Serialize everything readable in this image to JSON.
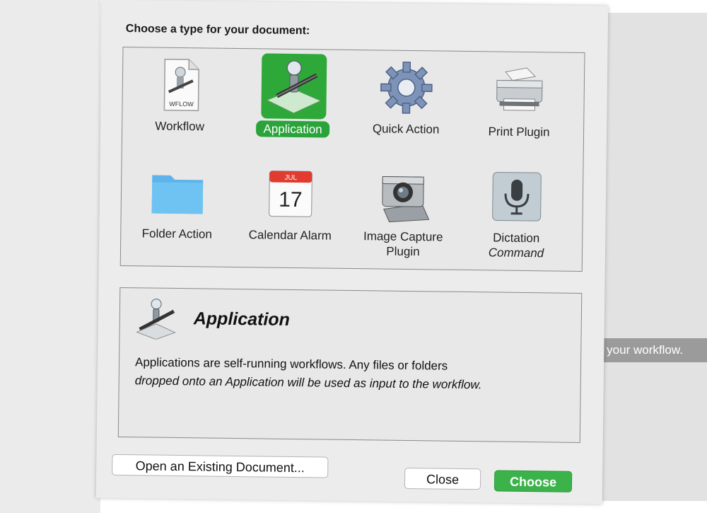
{
  "dialog": {
    "prompt": "Choose a type for your document:",
    "types": [
      {
        "label": "Workflow",
        "label2": "",
        "icon": "workflow-document-icon",
        "selected": false
      },
      {
        "label": "Application",
        "label2": "",
        "icon": "automator-robot-icon",
        "selected": true
      },
      {
        "label": "Quick Action",
        "label2": "",
        "icon": "gear-icon",
        "selected": false
      },
      {
        "label": "Print Plugin",
        "label2": "",
        "icon": "printer-icon",
        "selected": false
      },
      {
        "label": "Folder Action",
        "label2": "",
        "icon": "folder-icon",
        "selected": false
      },
      {
        "label": "Calendar Alarm",
        "label2": "",
        "icon": "calendar-icon",
        "selected": false
      },
      {
        "label": "Image Capture",
        "label2": "Plugin",
        "icon": "camera-icon",
        "selected": false
      },
      {
        "label": "Dictation",
        "label2": "Command",
        "icon": "microphone-icon",
        "selected": false
      }
    ],
    "workflow_badge": "WFLOW",
    "calendar_month": "JUL",
    "calendar_day": "17",
    "description": {
      "title": "Application",
      "line1": "Applications are self-running workflows. Any files or folders",
      "line2": "dropped onto an Application will be used as input to the workflow."
    },
    "buttons": {
      "open_label": "Open an Existing Document...",
      "close_label": "Close",
      "choose_label": "Choose"
    }
  },
  "background": {
    "hint_text": "d your workflow."
  },
  "colors": {
    "accent_green": "#2fa83a",
    "sheet_bg": "#ececec"
  }
}
